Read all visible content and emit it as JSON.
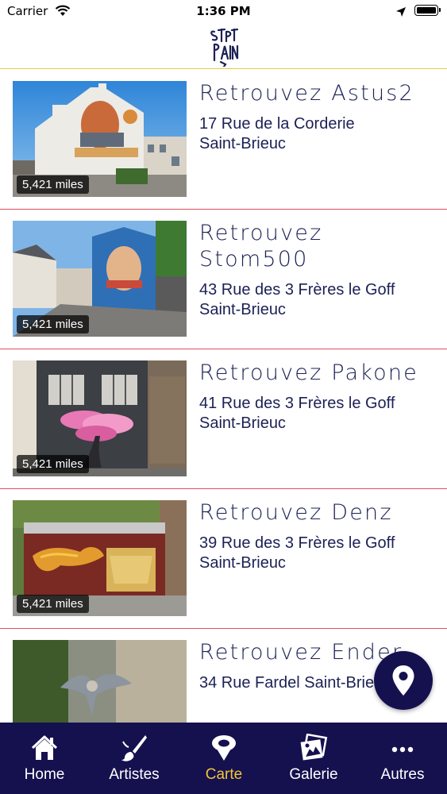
{
  "status_bar": {
    "carrier": "Carrier",
    "time": "1:36 PM",
    "icons": [
      "wifi-icon",
      "location-arrow-icon",
      "battery-icon"
    ]
  },
  "header": {
    "logo": "street-paint-logo",
    "accent_color": "#e8cc3d"
  },
  "list": {
    "items": [
      {
        "title": "Retrouvez Astus2",
        "address_line1": "17 Rue de la Corderie",
        "address_line2": "Saint-Brieuc",
        "distance": "5,421 miles"
      },
      {
        "title": "Retrouvez Stom500",
        "address_line1": "43 Rue des 3 Frères le Goff",
        "address_line2": "Saint-Brieuc",
        "distance": "5,421 miles"
      },
      {
        "title": "Retrouvez Pakone",
        "address_line1": "41 Rue des 3 Frères le Goff",
        "address_line2": "Saint-Brieuc",
        "distance": "5,421 miles"
      },
      {
        "title": "Retrouvez Denz",
        "address_line1": "39 Rue des 3 Frères le Goff",
        "address_line2": "Saint-Brieuc",
        "distance": "5,421 miles"
      },
      {
        "title": "Retrouvez Ender",
        "address_line1": "34 Rue Fardel Saint-Brieuc",
        "address_line2": "",
        "distance": ""
      }
    ],
    "divider_color": "#e74c5e",
    "text_color": "#1c2155"
  },
  "fab": {
    "icon": "map-pin-icon"
  },
  "tabbar": {
    "background": "#15114f",
    "active_color": "#f0c43a",
    "tabs": [
      {
        "label": "Home",
        "icon": "home-icon"
      },
      {
        "label": "Artistes",
        "icon": "paintbrush-icon"
      },
      {
        "label": "Carte",
        "icon": "map-pin-icon",
        "active": true
      },
      {
        "label": "Galerie",
        "icon": "gallery-icon"
      },
      {
        "label": "Autres",
        "icon": "more-icon"
      }
    ]
  }
}
